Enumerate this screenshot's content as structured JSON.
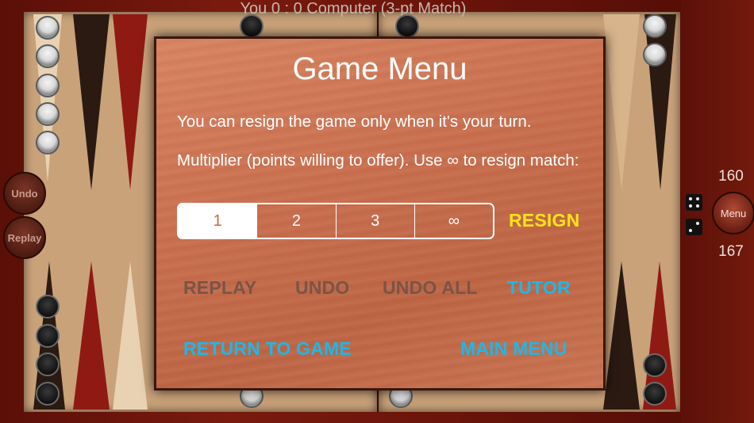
{
  "score_line": "You 0 : 0 Computer (3-pt Match)",
  "side_buttons": {
    "undo": "Undo",
    "replay": "Replay",
    "menu": "Menu"
  },
  "pip_counts": {
    "top": "160",
    "bottom": "167"
  },
  "colors": {
    "accent_yellow": "#ffe21a",
    "accent_blue": "#1cb8e8",
    "disabled": "#7a5448",
    "dialog": "#c96f4f"
  },
  "dialog": {
    "title": "Game Menu",
    "resign_note": "You can resign the game only when it's your turn.",
    "multiplier_note": "Multiplier (points willing to offer). Use ∞ to resign match:",
    "multiplier_options": [
      "1",
      "2",
      "3",
      "∞"
    ],
    "selected_multiplier": "1",
    "resign_label": "RESIGN",
    "actions": {
      "replay": "REPLAY",
      "undo": "UNDO",
      "undo_all": "UNDO ALL",
      "tutor": "TUTOR",
      "return_to_game": "RETURN TO GAME",
      "main_menu": "MAIN MENU"
    }
  }
}
